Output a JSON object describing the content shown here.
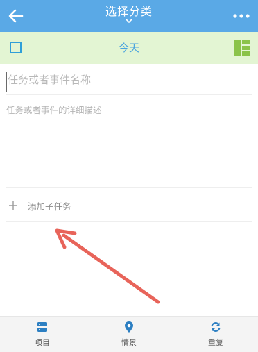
{
  "header": {
    "title": "选择分类",
    "back_icon": "arrow-left-icon",
    "more_icon": "more-dots-icon",
    "color": "#5aa9e6"
  },
  "datebar": {
    "label": "今天",
    "checkbox_icon": "checkbox-icon",
    "grid_icon": "grid-layout-icon",
    "color": "#e3f5d3"
  },
  "form": {
    "name_placeholder": "任务或者事件名称",
    "desc_placeholder": "任务或者事件的详细描述",
    "add_subtask_label": "添加子任务"
  },
  "annotation": {
    "icon": "red-arrow-icon",
    "color": "#e8645a"
  },
  "tabs": [
    {
      "label": "项目",
      "icon": "server-icon"
    },
    {
      "label": "情景",
      "icon": "location-pin-icon"
    },
    {
      "label": "重复",
      "icon": "refresh-icon"
    }
  ]
}
